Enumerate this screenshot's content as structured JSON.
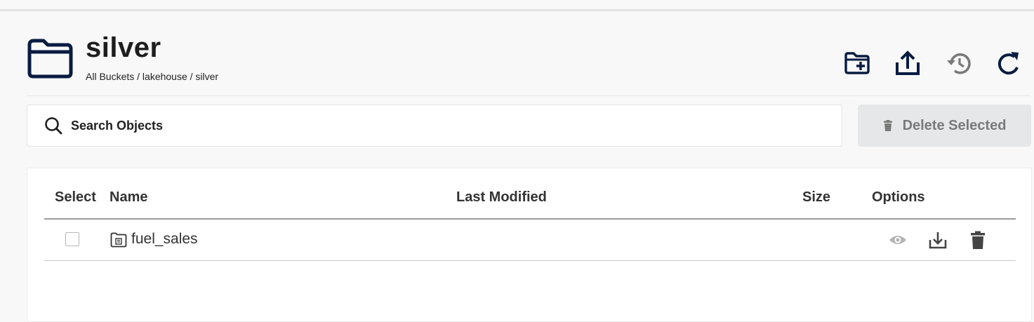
{
  "header": {
    "title": "silver",
    "breadcrumb": "All Buckets / lakehouse / silver",
    "actions": [
      {
        "name": "create-folder-icon"
      },
      {
        "name": "upload-icon"
      },
      {
        "name": "history-icon"
      },
      {
        "name": "refresh-icon"
      }
    ]
  },
  "search": {
    "placeholder": "Search Objects"
  },
  "toolbar": {
    "delete_selected_label": "Delete Selected"
  },
  "table": {
    "columns": [
      "Select",
      "Name",
      "Last Modified",
      "Size",
      "Options"
    ],
    "rows": [
      {
        "name": "fuel_sales",
        "last_modified": "",
        "size": "",
        "type": "folder"
      }
    ]
  },
  "colors": {
    "background": "#f8f8f8",
    "icon_dark": "#081c42",
    "disabled": "#7a7a7a"
  }
}
